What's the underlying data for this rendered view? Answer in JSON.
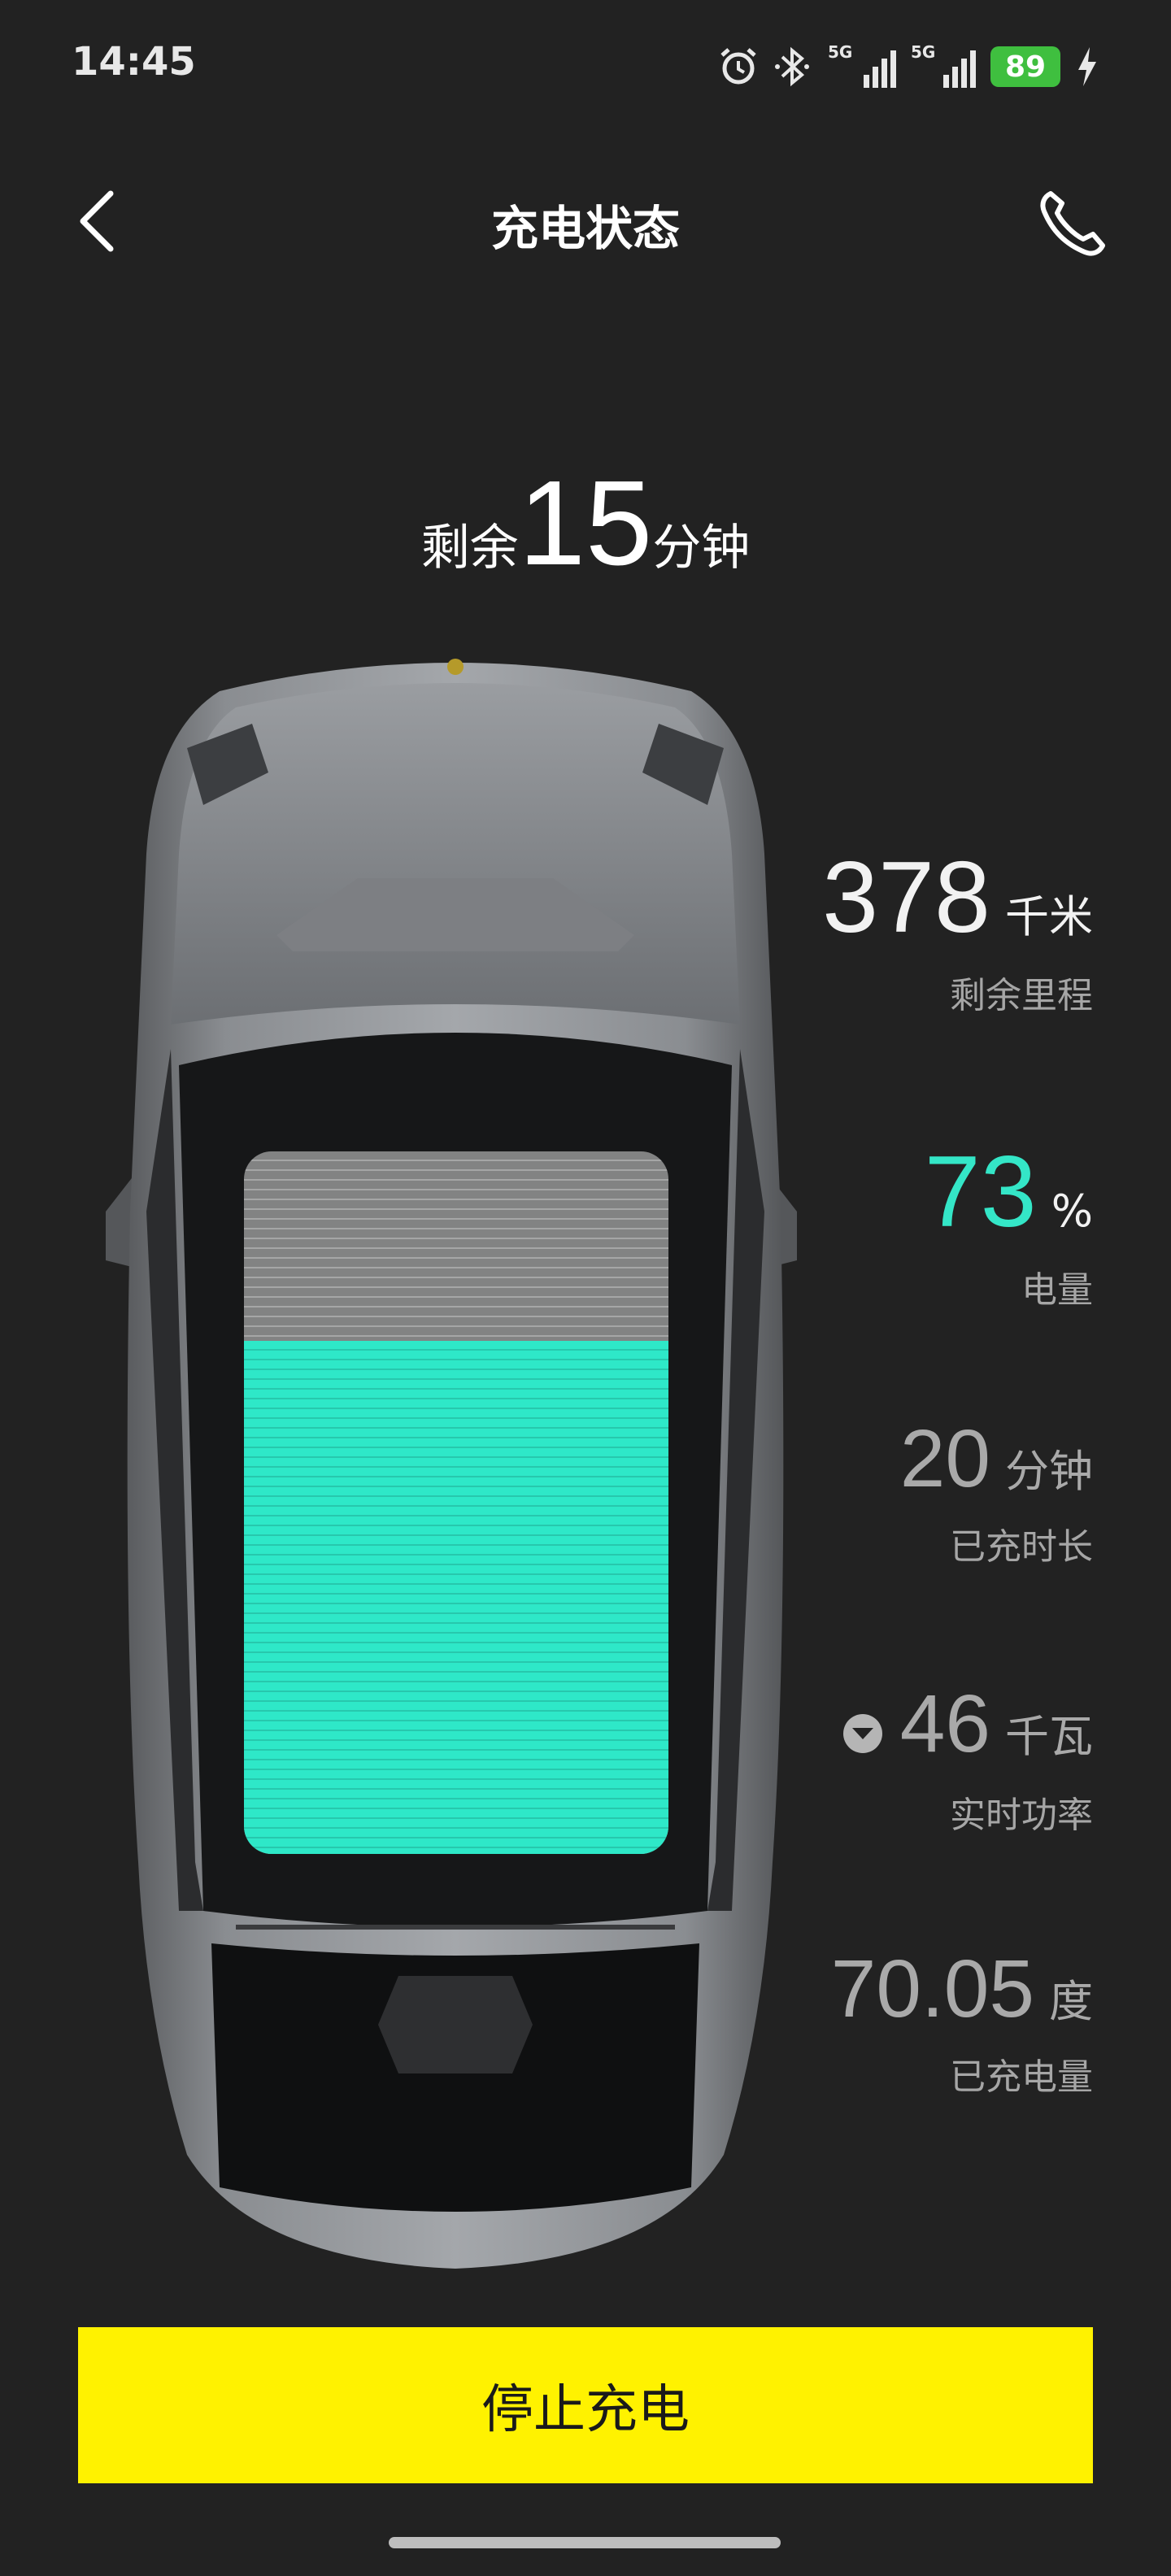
{
  "status_bar": {
    "time": "14:45",
    "signal_1_label": "5G",
    "signal_2_label": "5G",
    "battery_level": "89",
    "icons": [
      "alarm-icon",
      "bluetooth-icon",
      "signal-icon",
      "signal-icon",
      "battery-icon",
      "charging-bolt-icon"
    ]
  },
  "nav": {
    "title": "充电状态",
    "back_icon": "chevron-left-icon",
    "call_icon": "phone-icon"
  },
  "remaining": {
    "prefix": "剩余",
    "value": "15",
    "unit": "分钟"
  },
  "battery_visual": {
    "charge_fraction": 0.73,
    "fill_color": "#2ee8c8"
  },
  "stats": [
    {
      "value": "378",
      "unit": "千米",
      "label": "剩余里程"
    },
    {
      "value": "73",
      "unit": "%",
      "label": "电量"
    },
    {
      "value": "20",
      "unit": "分钟",
      "label": "已充时长"
    },
    {
      "value": "46",
      "unit": "千瓦",
      "label": "实时功率",
      "trend_icon": "chevron-down-circle-icon"
    },
    {
      "value": "70.05",
      "unit": "度",
      "label": "已充电量"
    }
  ],
  "colors": {
    "background": "#222222",
    "accent_teal": "#34e6c7",
    "button_yellow": "#fff200"
  },
  "actions": {
    "stop_label": "停止充电"
  }
}
